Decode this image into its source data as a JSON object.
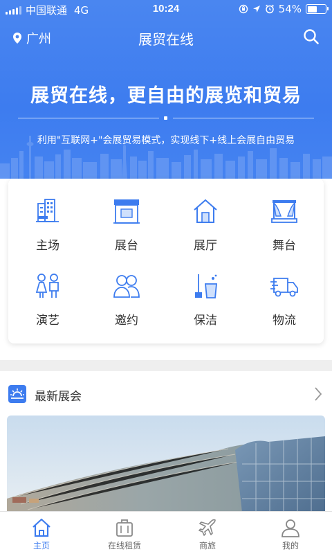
{
  "status_bar": {
    "carrier": "中国联通",
    "network": "4G",
    "time": "10:24",
    "battery": "54%"
  },
  "navbar": {
    "location": "广州",
    "title": "展贸在线"
  },
  "hero": {
    "slogan": "展贸在线，更自由的展览和贸易",
    "sub_slogan": "利用\"互联网+\"会展贸易模式，实现线下+线上会展自由贸易"
  },
  "grid": [
    {
      "label": "主场",
      "icon": "building-icon"
    },
    {
      "label": "展台",
      "icon": "booth-icon"
    },
    {
      "label": "展厅",
      "icon": "hall-icon"
    },
    {
      "label": "舞台",
      "icon": "stage-icon"
    },
    {
      "label": "演艺",
      "icon": "performers-icon"
    },
    {
      "label": "邀约",
      "icon": "invite-icon"
    },
    {
      "label": "保洁",
      "icon": "cleaning-icon"
    },
    {
      "label": "物流",
      "icon": "truck-icon"
    }
  ],
  "section": {
    "title": "最新展会"
  },
  "tabbar": [
    {
      "label": "主页",
      "active": true
    },
    {
      "label": "在线租赁",
      "active": false
    },
    {
      "label": "商旅",
      "active": false
    },
    {
      "label": "我的",
      "active": false
    }
  ],
  "colors": {
    "primary": "#3d7cef",
    "text": "#333333"
  }
}
